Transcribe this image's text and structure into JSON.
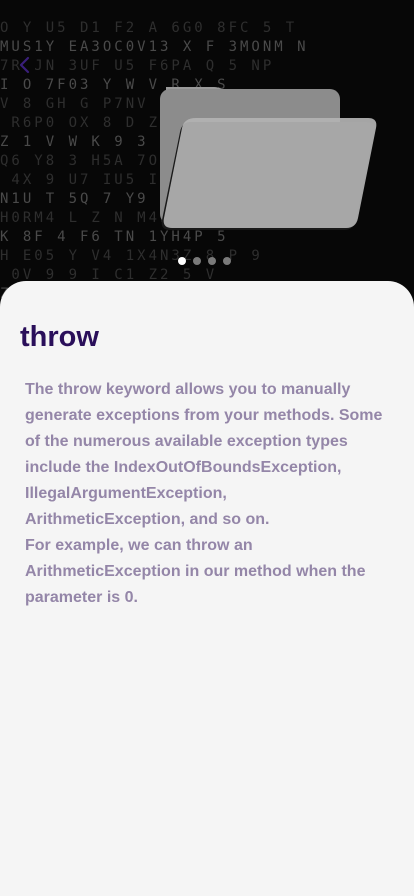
{
  "header": {
    "back_icon": "chevron-left-icon",
    "illustration": "folder-icon"
  },
  "pager": {
    "count": 4,
    "active_index": 0
  },
  "lesson": {
    "title": "throw",
    "paragraph_1": "The throw keyword allows you to manually generate exceptions from your methods. Some of the numerous available exception types include the IndexOutOfBoundsException, IllegalArgumentException, ArithmeticException, and so on.",
    "paragraph_2": "For example, we can throw an ArithmeticException in our method when the parameter is 0."
  },
  "colors": {
    "hero_background": "#070707",
    "title": "#2a0f5a",
    "body_text": "#9486a8",
    "back_icon": "#3a1f7a",
    "card": "#f5f5f5"
  }
}
